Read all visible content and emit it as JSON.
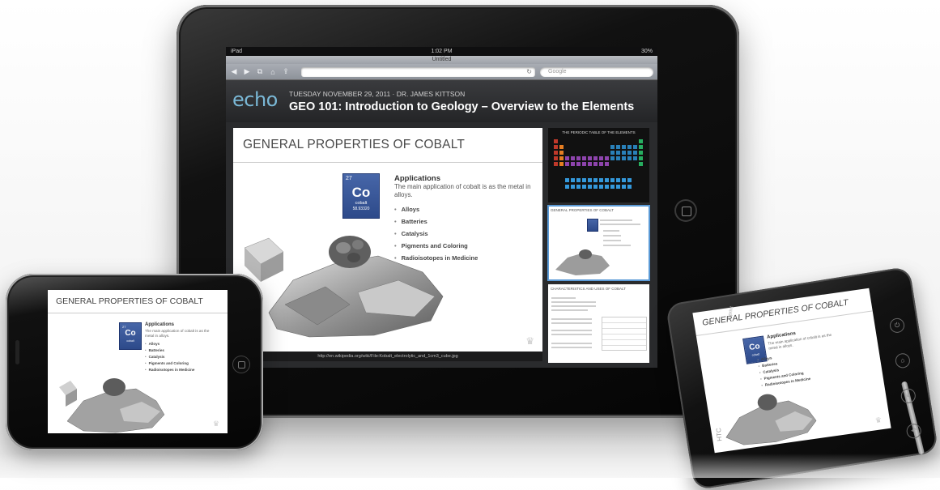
{
  "ipad": {
    "status_left": "iPad",
    "status_time": "1:02 PM",
    "status_battery": "30%",
    "browser_title": "Untitled",
    "search_placeholder": "Google",
    "echo_logo": "echo",
    "lecture_date": "TUESDAY NOVEMBER 29, 2011 · DR. JAMES KITTSON",
    "lecture_title": "GEO 101:  Introduction to Geology – Overview to the Elements",
    "slide_footer": "http://en.wikipedia.org/wiki/File:Kobalt_electrolytic_and_1cm3_cube.jpg",
    "thumbnails": [
      {
        "title": "THE PERIODIC TABLE OF THE ELEMENTS"
      },
      {
        "title": "GENERAL PROPERTIES OF COBALT"
      },
      {
        "title": "CHARACTERISTICS AND USES OF COBALT"
      }
    ]
  },
  "slide": {
    "title": "GENERAL PROPERTIES OF COBALT",
    "element": {
      "number": "27",
      "symbol": "Co",
      "name": "cobalt",
      "weight": "58.93320"
    },
    "applications_heading": "Applications",
    "applications_desc": "The main application of cobalt is as the metal in alloys.",
    "bullets": [
      "Alloys",
      "Batteries",
      "Catalysis",
      "Pigments and Coloring",
      "Radioisotopes in Medicine"
    ]
  },
  "htc": {
    "brand": "HTC",
    "sprint": "Sprint"
  },
  "colors": {
    "accent": "#7ab8d6",
    "tile": "#3a5a9c",
    "active_thumb": "#5b9ad6"
  }
}
